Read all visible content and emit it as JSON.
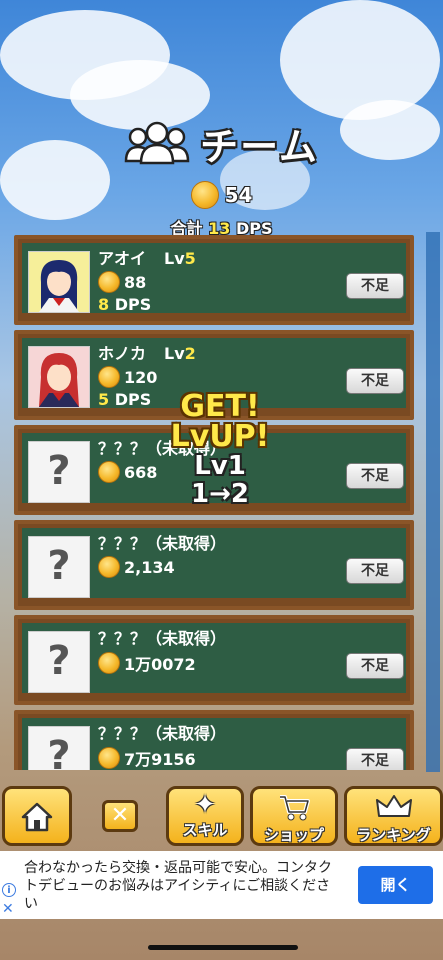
{
  "header": {
    "title": "チーム",
    "coins": "54",
    "total_prefix": "合計",
    "total_dps": "13",
    "total_suffix": "DPS"
  },
  "members": [
    {
      "name": "アオイ",
      "lv_label": "Lv",
      "lv": "5",
      "cost": "88",
      "dps": "8",
      "dps_label": "DPS",
      "button": "不足",
      "avatar": "girl-blue-hair"
    },
    {
      "name": "ホノカ",
      "lv_label": "Lv",
      "lv": "2",
      "cost": "120",
      "dps": "5",
      "dps_label": "DPS",
      "button": "不足",
      "avatar": "girl-red-hair"
    },
    {
      "name": "？？？（未取得）",
      "cost": "668",
      "button": "不足",
      "avatar": "unknown"
    },
    {
      "name": "？？？（未取得）",
      "cost": "2,134",
      "button": "不足",
      "avatar": "unknown"
    },
    {
      "name": "？？？（未取得）",
      "cost": "1万0072",
      "button": "不足",
      "avatar": "unknown"
    },
    {
      "name": "？？？（未取得）",
      "cost": "7万9156",
      "button": "不足",
      "avatar": "unknown"
    }
  ],
  "popup": {
    "line1": "GET!",
    "line2": "LvUP!",
    "line3": "Lv1",
    "line4": "1→2"
  },
  "nav": {
    "home_icon": "house-icon",
    "close_icon": "x-icon",
    "skill": "スキル",
    "shop": "ショップ",
    "ranking": "ランキング"
  },
  "ad": {
    "text": "合わなかったら交換・返品可能で安心。コンタクトデビューのお悩みはアイシティにご相談ください",
    "button": "開く"
  },
  "colors": {
    "accent": "#ffe94a",
    "board": "#2e5d44",
    "frame": "#7a4a22",
    "nav": "#f4b21c",
    "ad_button": "#1e6ee8"
  }
}
